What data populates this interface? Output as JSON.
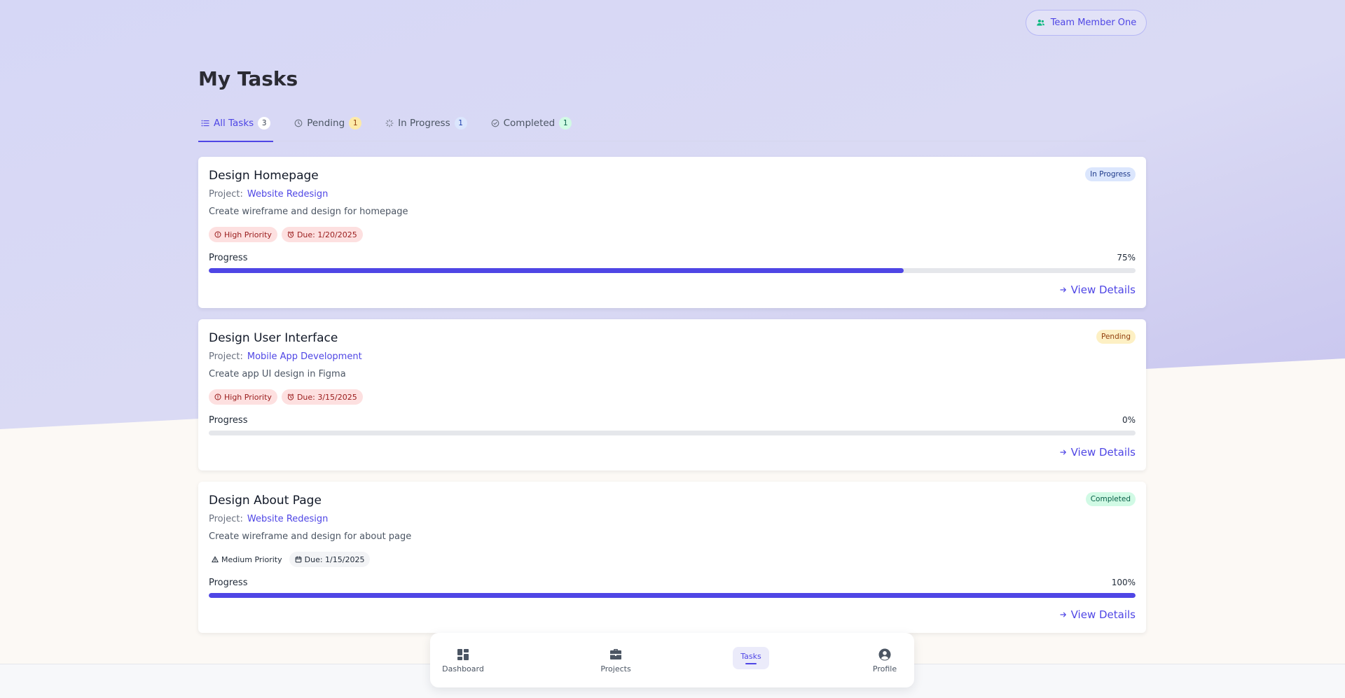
{
  "header": {
    "user_label": "Team Member One"
  },
  "page": {
    "title": "My Tasks"
  },
  "tabs": [
    {
      "label": "All Tasks",
      "count": "3",
      "active": true
    },
    {
      "label": "Pending",
      "count": "1"
    },
    {
      "label": "In Progress",
      "count": "1"
    },
    {
      "label": "Completed",
      "count": "1"
    }
  ],
  "tasks": [
    {
      "title": "Design Homepage",
      "status": "In Progress",
      "project_prefix": "Project:",
      "project": "Website Redesign",
      "description": "Create wireframe and design for homepage",
      "priority": "High Priority",
      "due": "Due: 1/20/2025",
      "progress_label": "Progress",
      "progress_text": "75%",
      "progress": 75,
      "view_details": "View Details"
    },
    {
      "title": "Design User Interface",
      "status": "Pending",
      "project_prefix": "Project:",
      "project": "Mobile App Development",
      "description": "Create app UI design in Figma",
      "priority": "High Priority",
      "due": "Due: 3/15/2025",
      "progress_label": "Progress",
      "progress_text": "0%",
      "progress": 0,
      "view_details": "View Details"
    },
    {
      "title": "Design About Page",
      "status": "Completed",
      "project_prefix": "Project:",
      "project": "Website Redesign",
      "description": "Create wireframe and design for about page",
      "priority": "Medium Priority",
      "due": "Due: 1/15/2025",
      "progress_label": "Progress",
      "progress_text": "100%",
      "progress": 100,
      "view_details": "View Details"
    }
  ],
  "bottom_nav": {
    "dashboard": "Dashboard",
    "projects": "Projects",
    "tasks": "Tasks",
    "profile": "Profile"
  },
  "colors": {
    "accent": "#4f46e5",
    "background_top": "#d9daf5",
    "background_bottom": "#fcf9f5"
  }
}
